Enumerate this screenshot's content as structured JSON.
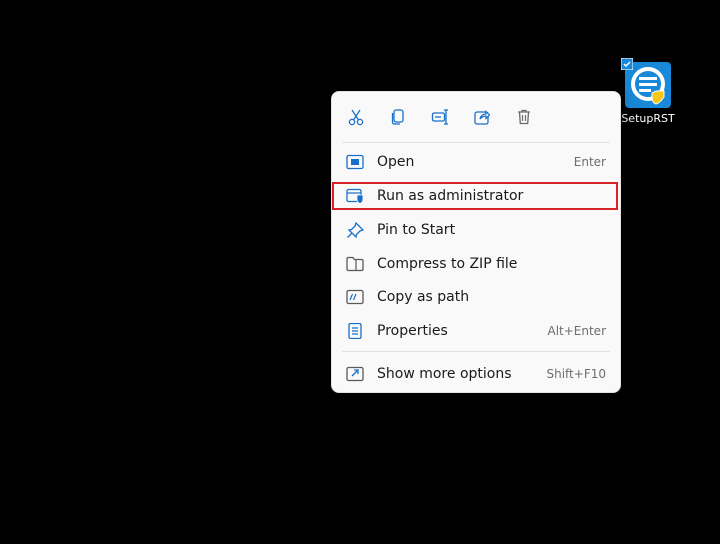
{
  "desktop": {
    "icon_label": "SetupRST",
    "icon_color": "#1a88d8"
  },
  "context_menu": {
    "toolbar": [
      {
        "name": "cut",
        "icon": "scissors-icon"
      },
      {
        "name": "copy",
        "icon": "copy-icon"
      },
      {
        "name": "rename",
        "icon": "rename-icon"
      },
      {
        "name": "share",
        "icon": "share-icon"
      },
      {
        "name": "delete",
        "icon": "trash-icon"
      }
    ],
    "items": [
      {
        "label": "Open",
        "shortcut": "Enter",
        "icon": "open-window-icon"
      },
      {
        "label": "Run as administrator",
        "shortcut": "",
        "icon": "shield-icon"
      },
      {
        "label": "Pin to Start",
        "shortcut": "",
        "icon": "pin-icon"
      },
      {
        "label": "Compress to ZIP file",
        "shortcut": "",
        "icon": "zip-folder-icon"
      },
      {
        "label": "Copy as path",
        "shortcut": "",
        "icon": "copy-path-icon"
      },
      {
        "label": "Properties",
        "shortcut": "Alt+Enter",
        "icon": "properties-icon"
      },
      {
        "label": "Show more options",
        "shortcut": "Shift+F10",
        "icon": "more-options-icon"
      }
    ],
    "accent": "#1a6fc8",
    "highlight_color": "#d8232a"
  }
}
